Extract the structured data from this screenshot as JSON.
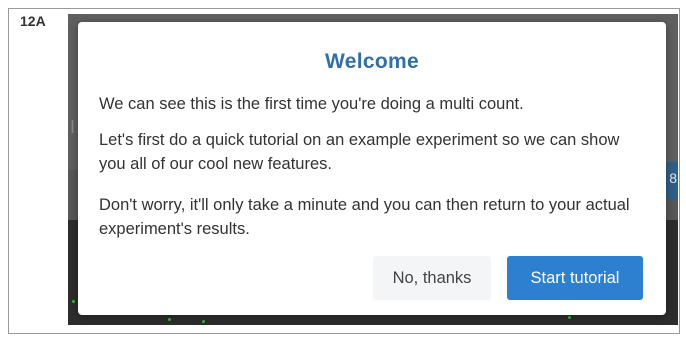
{
  "panel_label": "12A",
  "background": {
    "edge_glyph": "8"
  },
  "modal": {
    "title": "Welcome",
    "paragraphs": [
      "We can see this is the first time you're doing a multi count.",
      "Let's first do a quick tutorial on an example experiment so we can show you all of our cool new features.",
      "Don't worry, it'll only take a minute and you can then return to your actual experiment's results."
    ],
    "buttons": {
      "decline_label": "No, thanks",
      "start_label": "Start tutorial"
    }
  },
  "colors": {
    "title": "#2f6fab",
    "primary_button": "#2d7fcf",
    "secondary_button": "#f3f5f7",
    "overlay": "#3e3e3e"
  }
}
